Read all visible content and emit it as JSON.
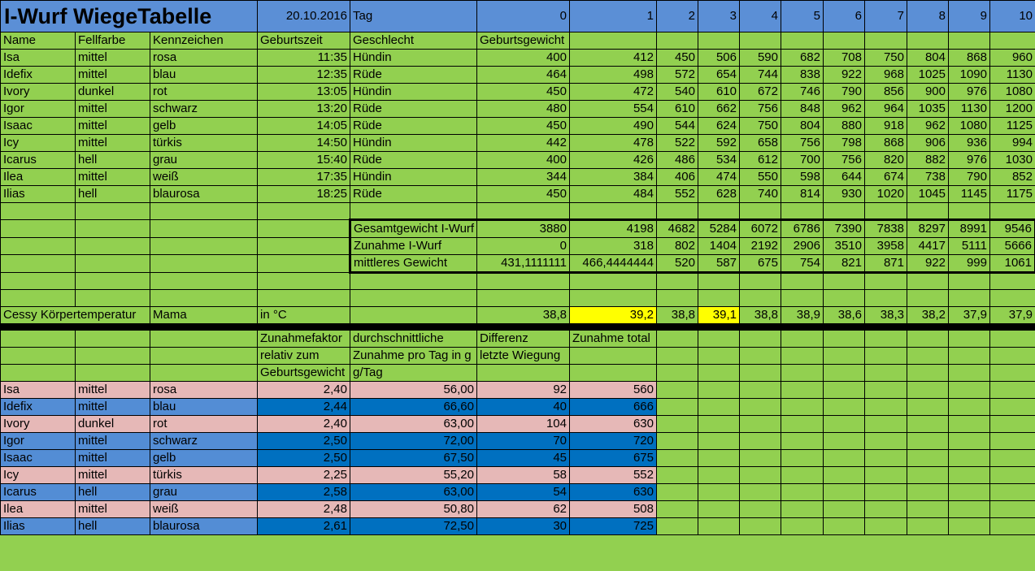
{
  "title": "I-Wurf WiegeTabelle",
  "date": "20.10.2016",
  "tag_label": "Tag",
  "days": [
    "0",
    "1",
    "2",
    "3",
    "4",
    "5",
    "6",
    "7",
    "8",
    "9",
    "10"
  ],
  "headers": [
    "Name",
    "Fellfarbe",
    "Kennzeichen",
    "Geburtszeit",
    "Geschlecht",
    "Geburtsgewicht"
  ],
  "puppies": [
    {
      "name": "Isa",
      "fell": "mittel",
      "kenn": "rosa",
      "zeit": "11:35",
      "sex": "Hündin",
      "w": [
        "400",
        "412",
        "450",
        "506",
        "590",
        "682",
        "708",
        "750",
        "804",
        "868",
        "960"
      ]
    },
    {
      "name": "Idefix",
      "fell": "mittel",
      "kenn": "blau",
      "zeit": "12:35",
      "sex": "Rüde",
      "w": [
        "464",
        "498",
        "572",
        "654",
        "744",
        "838",
        "922",
        "968",
        "1025",
        "1090",
        "1130"
      ]
    },
    {
      "name": "Ivory",
      "fell": "dunkel",
      "kenn": "rot",
      "zeit": "13:05",
      "sex": "Hündin",
      "w": [
        "450",
        "472",
        "540",
        "610",
        "672",
        "746",
        "790",
        "856",
        "900",
        "976",
        "1080"
      ]
    },
    {
      "name": "Igor",
      "fell": "mittel",
      "kenn": "schwarz",
      "zeit": "13:20",
      "sex": "Rüde",
      "w": [
        "480",
        "554",
        "610",
        "662",
        "756",
        "848",
        "962",
        "964",
        "1035",
        "1130",
        "1200"
      ]
    },
    {
      "name": "Isaac",
      "fell": "mittel",
      "kenn": "gelb",
      "zeit": "14:05",
      "sex": "Rüde",
      "w": [
        "450",
        "490",
        "544",
        "624",
        "750",
        "804",
        "880",
        "918",
        "962",
        "1080",
        "1125"
      ]
    },
    {
      "name": "Icy",
      "fell": "mittel",
      "kenn": "türkis",
      "zeit": "14:50",
      "sex": "Hündin",
      "w": [
        "442",
        "478",
        "522",
        "592",
        "658",
        "756",
        "798",
        "868",
        "906",
        "936",
        "994"
      ]
    },
    {
      "name": "Icarus",
      "fell": "hell",
      "kenn": "grau",
      "zeit": "15:40",
      "sex": "Rüde",
      "w": [
        "400",
        "426",
        "486",
        "534",
        "612",
        "700",
        "756",
        "820",
        "882",
        "976",
        "1030"
      ]
    },
    {
      "name": "Ilea",
      "fell": "mittel",
      "kenn": "weiß",
      "zeit": "17:35",
      "sex": "Hündin",
      "w": [
        "344",
        "384",
        "406",
        "474",
        "550",
        "598",
        "644",
        "674",
        "738",
        "790",
        "852"
      ]
    },
    {
      "name": "Ilias",
      "fell": "hell",
      "kenn": " blaurosa",
      "zeit": "18:25",
      "sex": "Rüde",
      "w": [
        "450",
        "484",
        "552",
        "628",
        "740",
        "814",
        "930",
        "1020",
        "1045",
        "1145",
        "1175"
      ]
    }
  ],
  "summary": [
    {
      "label": "Gesamtgewicht I-Wurf",
      "values": [
        "3880",
        "4198",
        "4682",
        "5284",
        "6072",
        "6786",
        "7390",
        "7838",
        "8297",
        "8991",
        "9546"
      ]
    },
    {
      "label": "Zunahme I-Wurf",
      "values": [
        "0",
        "318",
        "802",
        "1404",
        "2192",
        "2906",
        "3510",
        "3958",
        "4417",
        "5111",
        "5666"
      ]
    },
    {
      "label": "mittleres Gewicht",
      "values": [
        "431,1111111",
        "466,4444444",
        "520",
        "587",
        "675",
        "754",
        "821",
        "871",
        "922",
        "999",
        "1061"
      ]
    }
  ],
  "temp": {
    "label": "Cessy Körpertemperatur",
    "who": "Mama",
    "unit": "in °C",
    "values": [
      "38,8",
      "39,2",
      "38,8",
      "39,1",
      "38,8",
      "38,9",
      "38,6",
      "38,3",
      "38,2",
      "37,9",
      "37,9"
    ]
  },
  "colors": {
    "green": "#92d050",
    "title_blue": "#5b8fd6",
    "yellow": "#ffff00",
    "pink": "#e6b8b7",
    "light_blue": "#538dd5",
    "dark_blue": "#0070c0"
  },
  "stats_headers": [
    [
      "Zunahmefaktor",
      "durchschnittliche",
      "Differenz",
      "Zunahme total"
    ],
    [
      "relativ zum",
      "Zunahme pro Tag in g",
      "letzte Wiegung",
      ""
    ],
    [
      "Geburtsgewicht",
      "g/Tag",
      "",
      ""
    ]
  ],
  "stats": [
    {
      "name": "Isa",
      "fell": "mittel",
      "kenn": "rosa",
      "faktor": "2,40",
      "avg": "56,00",
      "diff": "92",
      "total": "560",
      "color": "pink"
    },
    {
      "name": "Idefix",
      "fell": "mittel",
      "kenn": "blau",
      "faktor": "2,44",
      "avg": "66,60",
      "diff": "40",
      "total": "666",
      "color": "blue"
    },
    {
      "name": "Ivory",
      "fell": "dunkel",
      "kenn": "rot",
      "faktor": "2,40",
      "avg": "63,00",
      "diff": "104",
      "total": "630",
      "color": "pink"
    },
    {
      "name": "Igor",
      "fell": "mittel",
      "kenn": "schwarz",
      "faktor": "2,50",
      "avg": "72,00",
      "diff": "70",
      "total": "720",
      "color": "blue"
    },
    {
      "name": "Isaac",
      "fell": "mittel",
      "kenn": "gelb",
      "faktor": "2,50",
      "avg": "67,50",
      "diff": "45",
      "total": "675",
      "color": "blue"
    },
    {
      "name": "Icy",
      "fell": "mittel",
      "kenn": "türkis",
      "faktor": "2,25",
      "avg": "55,20",
      "diff": "58",
      "total": "552",
      "color": "pink"
    },
    {
      "name": "Icarus",
      "fell": "hell",
      "kenn": "grau",
      "faktor": "2,58",
      "avg": "63,00",
      "diff": "54",
      "total": "630",
      "color": "blue"
    },
    {
      "name": "Ilea",
      "fell": "mittel",
      "kenn": "weiß",
      "faktor": "2,48",
      "avg": "50,80",
      "diff": "62",
      "total": "508",
      "color": "pink"
    },
    {
      "name": "Ilias",
      "fell": "hell",
      "kenn": " blaurosa",
      "faktor": "2,61",
      "avg": "72,50",
      "diff": "30",
      "total": "725",
      "color": "blue"
    }
  ]
}
